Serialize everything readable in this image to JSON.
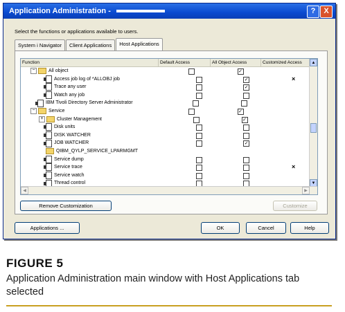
{
  "window": {
    "title": "Application Administration -",
    "help_symbol": "?",
    "close_symbol": "X",
    "hint": "Select the functions or applications available to users."
  },
  "tabs": [
    "System i Navigator",
    "Client Applications",
    "Host Applications"
  ],
  "table": {
    "headers": [
      "Function",
      "Default Access",
      "All Object Access",
      "Customized Access"
    ],
    "rows": [
      {
        "label": "All object",
        "indent": 1,
        "toggle": "−",
        "icon": "folder",
        "default": false,
        "all": true,
        "custom": ""
      },
      {
        "label": "Access job log of *ALLOBJ job",
        "indent": 2,
        "icon": "doc",
        "default": false,
        "all": true,
        "custom": "×"
      },
      {
        "label": "Trace any user",
        "indent": 2,
        "icon": "doc",
        "default": false,
        "all": true,
        "custom": ""
      },
      {
        "label": "Watch any job",
        "indent": 2,
        "icon": "doc",
        "default": false,
        "all": false,
        "custom": ""
      },
      {
        "label": "IBM Tivoli Directory Server Administrator",
        "indent": 1,
        "icon": "doc",
        "default": false,
        "all": false,
        "custom": ""
      },
      {
        "label": "Service",
        "indent": 1,
        "toggle": "−",
        "icon": "folder",
        "default": false,
        "all": true,
        "custom": ""
      },
      {
        "label": "Cluster Management",
        "indent": 2,
        "toggle": "+",
        "icon": "folder",
        "default": false,
        "all": true,
        "custom": ""
      },
      {
        "label": "Disk units",
        "indent": 2,
        "icon": "doc",
        "default": false,
        "all": false,
        "custom": ""
      },
      {
        "label": "DISK WATCHER",
        "indent": 2,
        "icon": "doc",
        "default": false,
        "all": false,
        "custom": ""
      },
      {
        "label": "JOB WATCHER",
        "indent": 2,
        "icon": "doc",
        "default": false,
        "all": true,
        "custom": ""
      },
      {
        "label": "QIBM_QYLP_SERVICE_LPARMGMT",
        "indent": 2,
        "icon": "folder",
        "default": null,
        "all": null,
        "custom": ""
      },
      {
        "label": "Service dump",
        "indent": 2,
        "icon": "doc",
        "default": false,
        "all": false,
        "custom": ""
      },
      {
        "label": "Service trace",
        "indent": 2,
        "icon": "doc",
        "default": false,
        "all": false,
        "custom": "×"
      },
      {
        "label": "Service watch",
        "indent": 2,
        "icon": "doc",
        "default": false,
        "all": false,
        "custom": ""
      },
      {
        "label": "Thread control",
        "indent": 2,
        "icon": "doc",
        "default": false,
        "all": false,
        "custom": ""
      }
    ]
  },
  "buttons": {
    "remove": "Remove Customization",
    "customize": "Customize",
    "applications": "Applications ...",
    "ok": "OK",
    "cancel": "Cancel",
    "help": "Help"
  },
  "caption": {
    "figure": "FIGURE 5",
    "text": "Application Administration main window with Host Applications tab selected"
  },
  "colors": {
    "title_bar": "#0a4ad0",
    "caption_rule": "#c8a020"
  }
}
